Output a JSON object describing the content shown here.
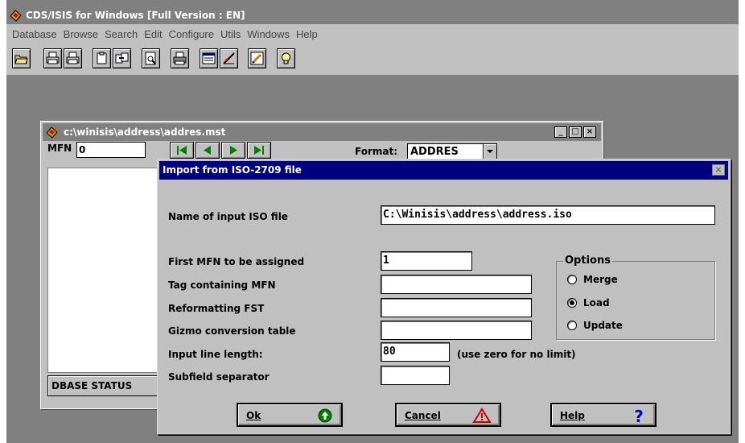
{
  "app": {
    "title": "CDS/ISIS for Windows [Full Version : EN]",
    "menu": [
      "Database",
      "Browse",
      "Search",
      "Edit",
      "Configure",
      "Utils",
      "Windows",
      "Help"
    ]
  },
  "toolbar": {
    "icons": [
      "open-folder-icon",
      "print-txt-icon",
      "print-rtf-icon",
      "clipboard-icon",
      "copy-record-icon",
      "preview-icon",
      "printer-icon",
      "window-icon",
      "draw-icon",
      "edit-pencil-icon",
      "lightbulb-icon"
    ]
  },
  "db_window": {
    "title": "c:\\winisis\\address\\addres.mst",
    "mfn_label": "MFN",
    "mfn_value": "0",
    "format_label": "Format:",
    "format_value": "ADDRES",
    "status_label": "DBASE STATUS"
  },
  "dialog": {
    "title": "Import from ISO-2709 file",
    "input_file_label": "Name of input ISO file",
    "input_file_value": "C:\\Winisis\\address\\address.iso",
    "first_mfn_label": "First MFN to be assigned",
    "first_mfn_value": "1",
    "tag_mfn_label": "Tag containing MFN",
    "tag_mfn_value": "",
    "reformat_fst_label": "Reformatting FST",
    "reformat_fst_value": "",
    "gizmo_label": "Gizmo conversion table",
    "gizmo_value": "",
    "line_length_label": "Input line length:",
    "line_length_value": "80",
    "line_length_hint": "(use zero for no limit)",
    "subfield_label": "Subfield separator",
    "subfield_value": "",
    "options": {
      "legend": "Options",
      "merge": "Merge",
      "load": "Load",
      "update": "Update",
      "selected": "Load"
    },
    "buttons": {
      "ok": "Ok",
      "cancel": "Cancel",
      "help": "Help"
    }
  },
  "colors": {
    "title_active": "#000080",
    "title_inactive": "#808080",
    "face": "#c0c0c0",
    "workspace": "#808080",
    "ok_icon": "#008000",
    "warning_icon": "#cc0000",
    "help_icon": "#0000cc"
  }
}
